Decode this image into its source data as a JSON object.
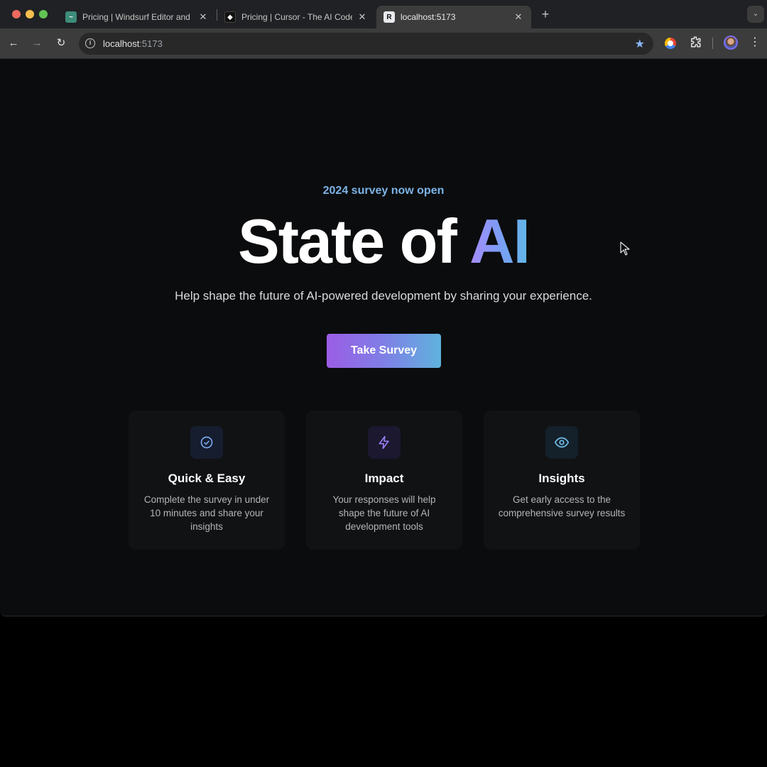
{
  "browser": {
    "tabs": [
      {
        "title": "Pricing | Windsurf Editor and ...",
        "favicon": "windsurf-favicon"
      },
      {
        "title": "Pricing | Cursor - The AI Code ...",
        "favicon": "cursor-favicon"
      },
      {
        "title": "localhost:5173",
        "favicon": "localhost-favicon",
        "active": true
      }
    ],
    "address": {
      "host": "localhost",
      "port": ":5173"
    }
  },
  "hero": {
    "eyebrow": "2024 survey now open",
    "title_plain": "State of",
    "title_highlight": "AI",
    "subtitle": "Help shape the future of AI-powered development by sharing your experience.",
    "cta_label": "Take Survey"
  },
  "features": [
    {
      "icon": "check-circle-icon",
      "title": "Quick & Easy",
      "description": "Complete the survey in under 10 minutes and share your insights",
      "icon_color": "#7aa8ef"
    },
    {
      "icon": "lightning-icon",
      "title": "Impact",
      "description": "Your responses will help shape the future of AI development tools",
      "icon_color": "#9a7cf0"
    },
    {
      "icon": "eye-icon",
      "title": "Insights",
      "description": "Get early access to the comprehensive survey results",
      "icon_color": "#6cb9e3"
    }
  ],
  "colors": {
    "accent_purple": "#9b5de5",
    "accent_blue": "#5fb3dd",
    "eyebrow": "#7db3e6",
    "background": "#0b0c0d"
  }
}
